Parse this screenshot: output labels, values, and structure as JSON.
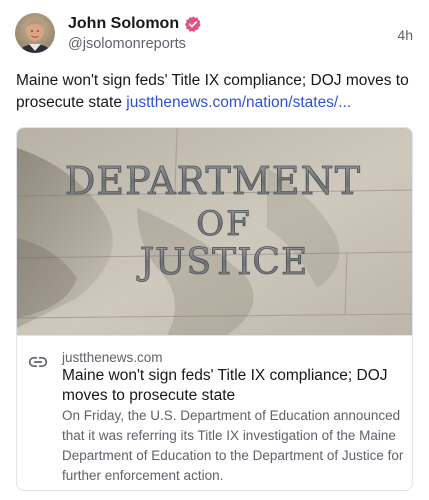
{
  "author": {
    "name": "John Solomon",
    "handle": "@jsolomonreports",
    "time": "4h",
    "verified_color": "#e5517e"
  },
  "post": {
    "text": "Maine won't sign feds' Title IX compliance; DOJ moves to prosecute state",
    "link_text": "justthenews.com/nation/states/..."
  },
  "card": {
    "image_text": [
      "DEPARTMENT",
      "OF",
      "JUSTICE"
    ],
    "domain": "justthenews.com",
    "title": "Maine won't sign feds' Title IX compliance; DOJ moves to prosecute state",
    "description": "On Friday, the U.S. Department of Education announced that it was referring its Title IX investigation of the Maine Department of Education to the Department of Justice for further enforcement action."
  },
  "colors": {
    "link": "#3150d6",
    "text": "#17181c",
    "muted": "#60626b"
  },
  "icons": {
    "avatar": "avatar",
    "verified": "verified-badge-icon",
    "link": "link-icon"
  }
}
